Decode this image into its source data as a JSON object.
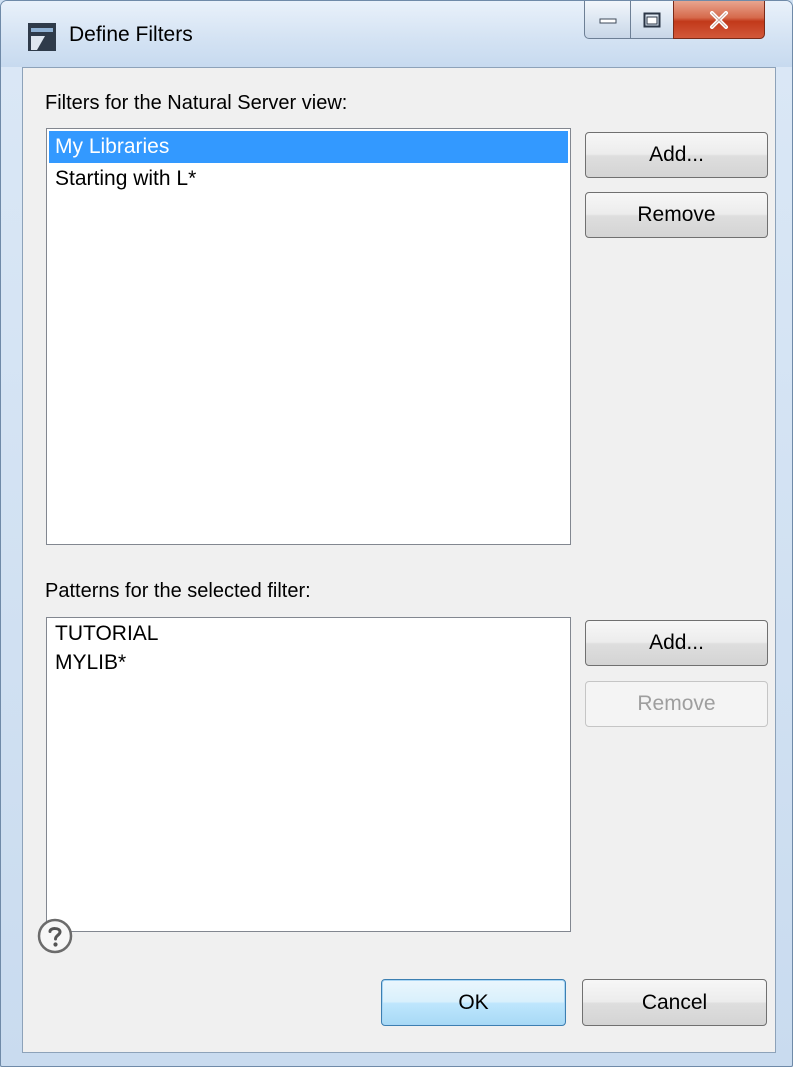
{
  "window": {
    "title": "Define Filters"
  },
  "filters": {
    "label": "Filters for the Natural Server view:",
    "items": [
      "My Libraries",
      "Starting with L*"
    ],
    "selected_index": 0,
    "add_label": "Add...",
    "remove_label": "Remove"
  },
  "patterns": {
    "label": "Patterns for the selected filter:",
    "items": [
      "TUTORIAL",
      "MYLIB*"
    ],
    "add_label": "Add...",
    "remove_label": "Remove",
    "remove_disabled": true
  },
  "footer": {
    "ok_label": "OK",
    "cancel_label": "Cancel"
  },
  "icons": {
    "app": "define-filters-app-icon",
    "help": "help-icon",
    "minimize": "minimize-icon",
    "maximize": "maximize-icon",
    "close": "close-icon"
  },
  "colors": {
    "selection": "#3399ff",
    "close_button": "#c2391a"
  }
}
